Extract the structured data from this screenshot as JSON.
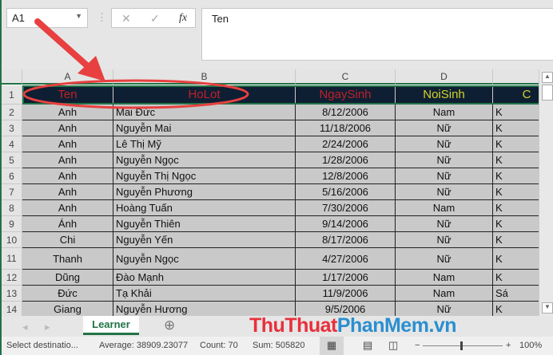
{
  "name_box": "A1",
  "formula_bar": {
    "cancel_icon": "✕",
    "enter_icon": "✓",
    "fx_label": "fx",
    "value": "Ten"
  },
  "columns": [
    "A",
    "B",
    "C",
    "D",
    ""
  ],
  "header_row": {
    "row": "1",
    "cells": [
      "Ten",
      "HoLot",
      "NgaySinh",
      "NoiSinh",
      "C"
    ],
    "colors": [
      "#c0202a",
      "#c0202a",
      "#c0202a",
      "#d4d42a",
      "#d4d42a"
    ]
  },
  "rows": [
    {
      "row": "2",
      "cells": [
        "Anh",
        "Mai Đức",
        "8/12/2006",
        "Nam",
        "K"
      ]
    },
    {
      "row": "3",
      "cells": [
        "Anh",
        "Nguyễn Mai",
        "11/18/2006",
        "Nữ",
        "K"
      ]
    },
    {
      "row": "4",
      "cells": [
        "Anh",
        "Lê Thị Mỹ",
        "2/24/2006",
        "Nữ",
        "K"
      ]
    },
    {
      "row": "5",
      "cells": [
        "Anh",
        "Nguyễn Ngọc",
        "1/28/2006",
        "Nữ",
        "K"
      ]
    },
    {
      "row": "6",
      "cells": [
        "Anh",
        "Nguyễn Thị Ngọc",
        "12/8/2006",
        "Nữ",
        "K"
      ]
    },
    {
      "row": "7",
      "cells": [
        "Anh",
        "Nguyễn Phương",
        "5/16/2006",
        "Nữ",
        "K"
      ]
    },
    {
      "row": "8",
      "cells": [
        "Anh",
        "Hoàng Tuấn",
        "7/30/2006",
        "Nam",
        "K"
      ]
    },
    {
      "row": "9",
      "cells": [
        "Ánh",
        "Nguyễn Thiên",
        "9/14/2006",
        "Nữ",
        "K"
      ]
    },
    {
      "row": "10",
      "cells": [
        "Chi",
        "Nguyễn Yến",
        "8/17/2006",
        "Nữ",
        "K"
      ]
    },
    {
      "row": "11",
      "cells": [
        "Thanh",
        "Nguyễn Ngọc",
        "4/27/2006",
        "Nữ",
        "K"
      ]
    },
    {
      "row": "12",
      "cells": [
        "Dũng",
        "Đào Mạnh",
        "1/17/2006",
        "Nam",
        "K"
      ]
    },
    {
      "row": "13",
      "cells": [
        "Đức",
        "Tạ Khải",
        "11/9/2006",
        "Nam",
        "Sá"
      ]
    },
    {
      "row": "14",
      "cells": [
        "Giang",
        "Nguyễn Hương",
        "9/5/2006",
        "Nữ",
        "K"
      ]
    }
  ],
  "sheet_tab": "Learner",
  "add_sheet_icon": "⊕",
  "watermark": "ThuThuatPhanMem.vn",
  "status": {
    "mode": "Select destinatio...",
    "average": "Average: 38909.23077",
    "count": "Count: 70",
    "sum": "Sum: 505820",
    "zoom": "100%"
  },
  "annotation_color": "#e84040"
}
